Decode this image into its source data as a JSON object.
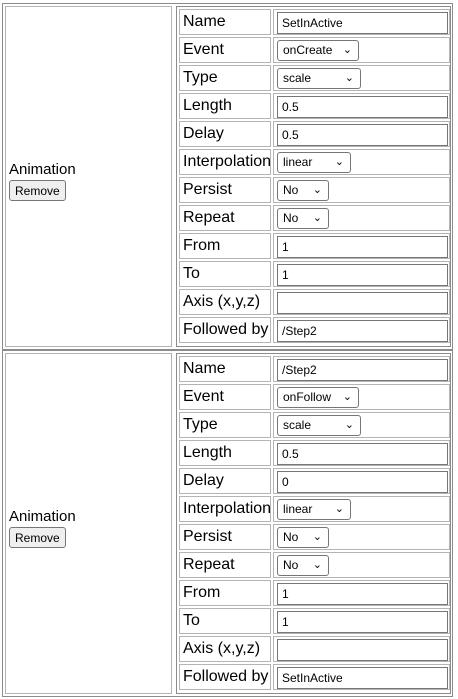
{
  "blocks": [
    {
      "section_label": "Animation",
      "remove_label": "Remove",
      "rows": {
        "name": {
          "label": "Name",
          "value": "SetInActive"
        },
        "event": {
          "label": "Event",
          "value": "onCreate"
        },
        "type": {
          "label": "Type",
          "value": "scale"
        },
        "length": {
          "label": "Length",
          "value": "0.5"
        },
        "delay": {
          "label": "Delay",
          "value": "0.5"
        },
        "interpolation": {
          "label": "Interpolation",
          "value": "linear"
        },
        "persist": {
          "label": "Persist",
          "value": "No"
        },
        "repeat": {
          "label": "Repeat",
          "value": "No"
        },
        "from": {
          "label": "From",
          "value": "1"
        },
        "to": {
          "label": "To",
          "value": "1"
        },
        "axis": {
          "label": "Axis (x,y,z)",
          "value": ""
        },
        "followed": {
          "label": "Followed by",
          "value": "/Step2"
        }
      }
    },
    {
      "section_label": "Animation",
      "remove_label": "Remove",
      "rows": {
        "name": {
          "label": "Name",
          "value": "/Step2"
        },
        "event": {
          "label": "Event",
          "value": "onFollow"
        },
        "type": {
          "label": "Type",
          "value": "scale"
        },
        "length": {
          "label": "Length",
          "value": "0.5"
        },
        "delay": {
          "label": "Delay",
          "value": "0"
        },
        "interpolation": {
          "label": "Interpolation",
          "value": "linear"
        },
        "persist": {
          "label": "Persist",
          "value": "No"
        },
        "repeat": {
          "label": "Repeat",
          "value": "No"
        },
        "from": {
          "label": "From",
          "value": "1"
        },
        "to": {
          "label": "To",
          "value": "1"
        },
        "axis": {
          "label": "Axis (x,y,z)",
          "value": ""
        },
        "followed": {
          "label": "Followed by",
          "value": "SetInActive"
        }
      }
    }
  ]
}
